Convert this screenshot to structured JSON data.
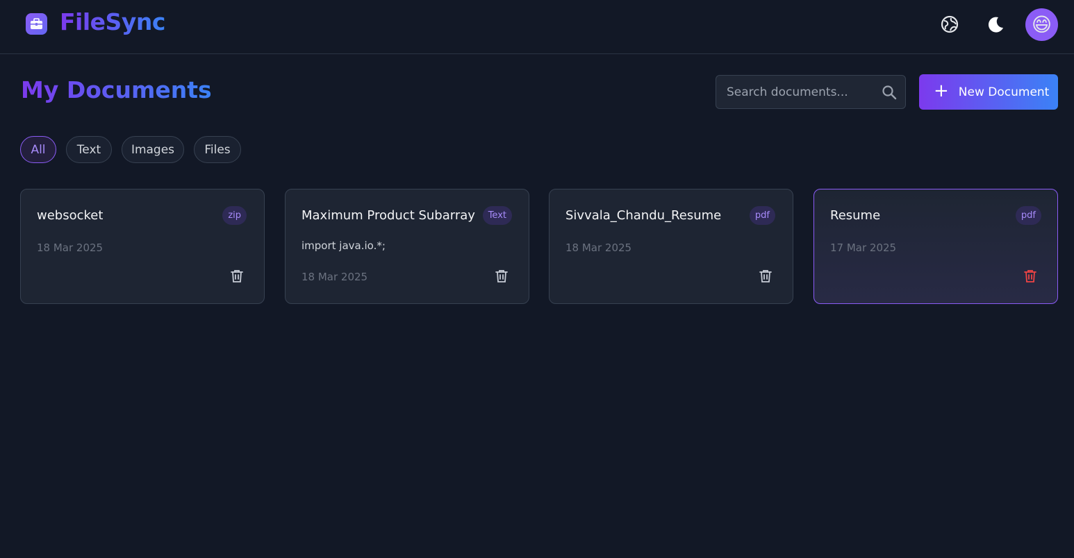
{
  "app": {
    "brand": "FileSync",
    "avatar_emoji": "😄"
  },
  "colors": {
    "background": "#121826",
    "accent_start": "#7c3aed",
    "accent_end": "#3b82f6",
    "danger": "#ef4444"
  },
  "main": {
    "title": "My Documents",
    "search": {
      "placeholder": "Search documents...",
      "value": ""
    },
    "new_button_label": "New Document",
    "filters": [
      {
        "label": "All",
        "active": true
      },
      {
        "label": "Text",
        "active": false
      },
      {
        "label": "Images",
        "active": false
      },
      {
        "label": "Files",
        "active": false
      }
    ],
    "documents": [
      {
        "name": "websocket",
        "type": "zip",
        "date": "18 Mar 2025",
        "preview": ""
      },
      {
        "name": "Maximum Product Subarray",
        "type": "Text",
        "date": "18 Mar 2025",
        "preview": "import java.io.*;"
      },
      {
        "name": "Sivvala_Chandu_Resume",
        "type": "pdf",
        "date": "18 Mar 2025",
        "preview": ""
      },
      {
        "name": "Resume",
        "type": "pdf",
        "date": "17 Mar 2025",
        "preview": ""
      }
    ]
  },
  "icons": {
    "logo": "briefcase-icon",
    "language": "globe-icon",
    "theme": "moon-icon",
    "search": "search-icon",
    "add": "plus-icon",
    "delete": "trash-icon"
  }
}
